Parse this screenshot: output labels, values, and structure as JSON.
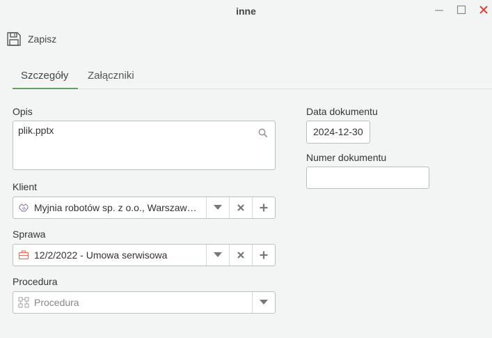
{
  "window": {
    "title": "inne"
  },
  "toolbar": {
    "save_label": "Zapisz"
  },
  "tabs": [
    {
      "label": "Szczegóły",
      "active": true
    },
    {
      "label": "Załączniki",
      "active": false
    }
  ],
  "form": {
    "opis": {
      "label": "Opis",
      "value": "plik.pptx"
    },
    "klient": {
      "label": "Klient",
      "value": "Myjnia robotów sp. z o.o., Warszaw…",
      "icon": "handshake-icon"
    },
    "sprawa": {
      "label": "Sprawa",
      "value": "12/2/2022 - Umowa serwisowa",
      "icon": "briefcase-icon"
    },
    "procedura": {
      "label": "Procedura",
      "placeholder": "Procedura",
      "icon": "procedure-icon"
    },
    "data_dokumentu": {
      "label": "Data dokumentu",
      "value": "2024-12-30"
    },
    "numer_dokumentu": {
      "label": "Numer dokumentu",
      "value": ""
    }
  },
  "colors": {
    "accent": "#5aa75a",
    "close": "#d9453a",
    "briefcase": "#e07060"
  }
}
